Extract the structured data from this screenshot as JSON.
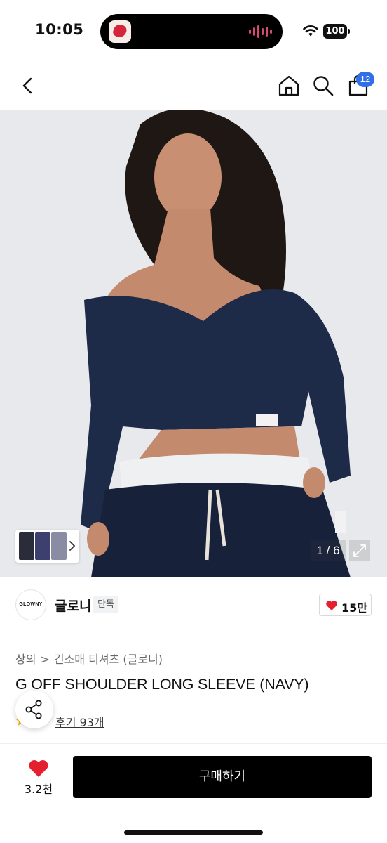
{
  "status_bar": {
    "time": "10:05",
    "battery": "100",
    "wifi_icon": "wifi-icon"
  },
  "nav": {
    "back_icon": "chevron-left-icon",
    "home_icon": "home-icon",
    "search_icon": "search-icon",
    "bag_icon": "shopping-bag-icon",
    "bag_count": "12",
    "badge_color": "#2f6fe8"
  },
  "gallery": {
    "counter": "1 / 6",
    "current_image": 1,
    "total_images": 6,
    "expand_icon": "expand-icon",
    "thumbnail_arrow_icon": "chevron-right-icon"
  },
  "brand": {
    "logo_text": "GLOWNY",
    "name": "글로니",
    "badge": "단독",
    "like_count": "15만",
    "like_icon": "heart-icon",
    "heart_color": "#e5202e"
  },
  "product": {
    "breadcrumb": [
      "상의",
      "긴소매 티셔츠 (글로니)"
    ],
    "breadcrumb_separator": ">",
    "title": "G OFF SHOULDER LONG SLEEVE (NAVY)",
    "review_label": "후기 93개",
    "star_icon": "star-icon",
    "share_icon": "share-icon"
  },
  "bottom_bar": {
    "wish_count": "3.2천",
    "wish_icon": "heart-icon",
    "buy_label": "구매하기"
  }
}
